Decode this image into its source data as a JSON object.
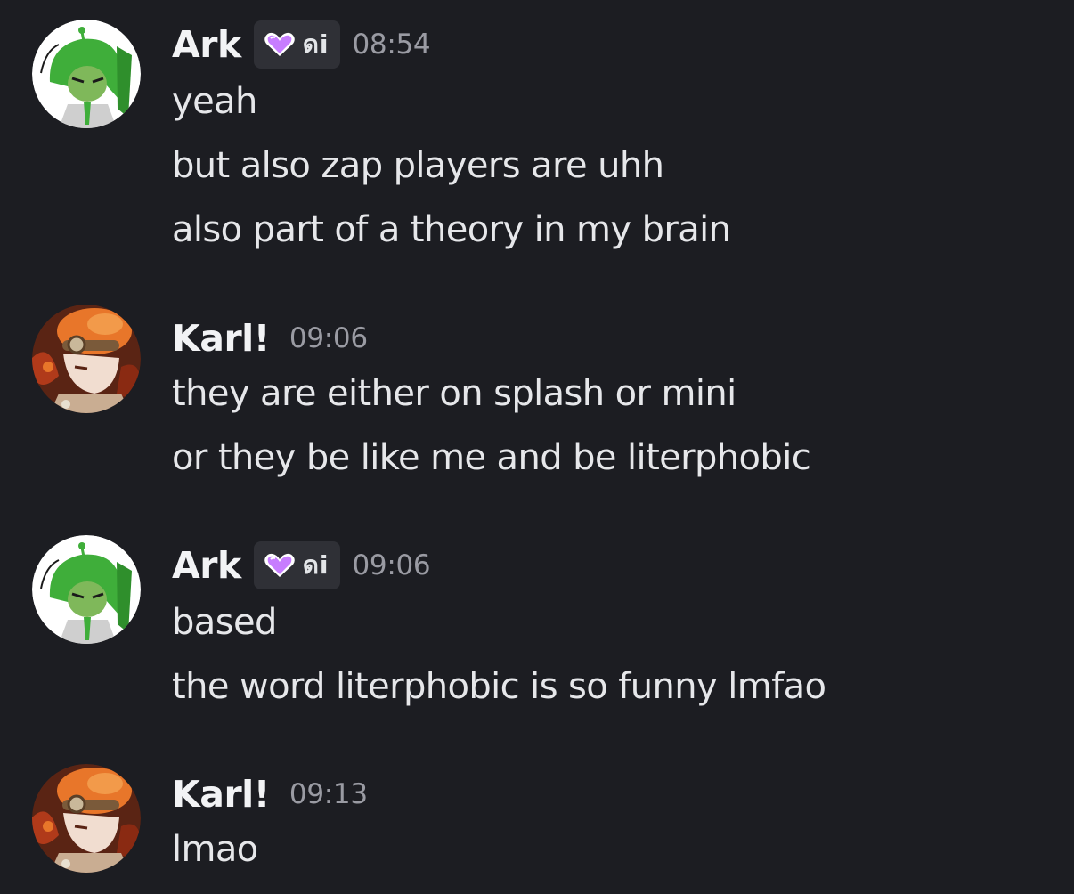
{
  "messages": [
    {
      "author": "Ark",
      "avatar_icon": "green-haired-character-avatar",
      "tag": {
        "icon": "purple-heart-icon",
        "text": "ดi"
      },
      "time": "08:54",
      "lines": [
        "yeah",
        "but also zap players are uhh",
        "also part of a theory in my brain"
      ]
    },
    {
      "author": "Karl!",
      "avatar_icon": "orange-hat-character-avatar",
      "time": "09:06",
      "lines": [
        "they are either on splash or mini",
        "or they be like me and be literphobic"
      ]
    },
    {
      "author": "Ark",
      "avatar_icon": "green-haired-character-avatar",
      "tag": {
        "icon": "purple-heart-icon",
        "text": "ดi"
      },
      "time": "09:06",
      "lines": [
        "based",
        "the word literphobic is so funny lmfao"
      ]
    },
    {
      "author": "Karl!",
      "avatar_icon": "orange-hat-character-avatar",
      "time": "09:13",
      "lines": [
        "lmao"
      ]
    }
  ],
  "colors": {
    "background": "#1c1d22",
    "username": "#f2f3f5",
    "message_text": "#e6e7ea",
    "timestamp": "#9a9ba3",
    "tag_background": "#2f3036",
    "heart": "#c77dff"
  }
}
